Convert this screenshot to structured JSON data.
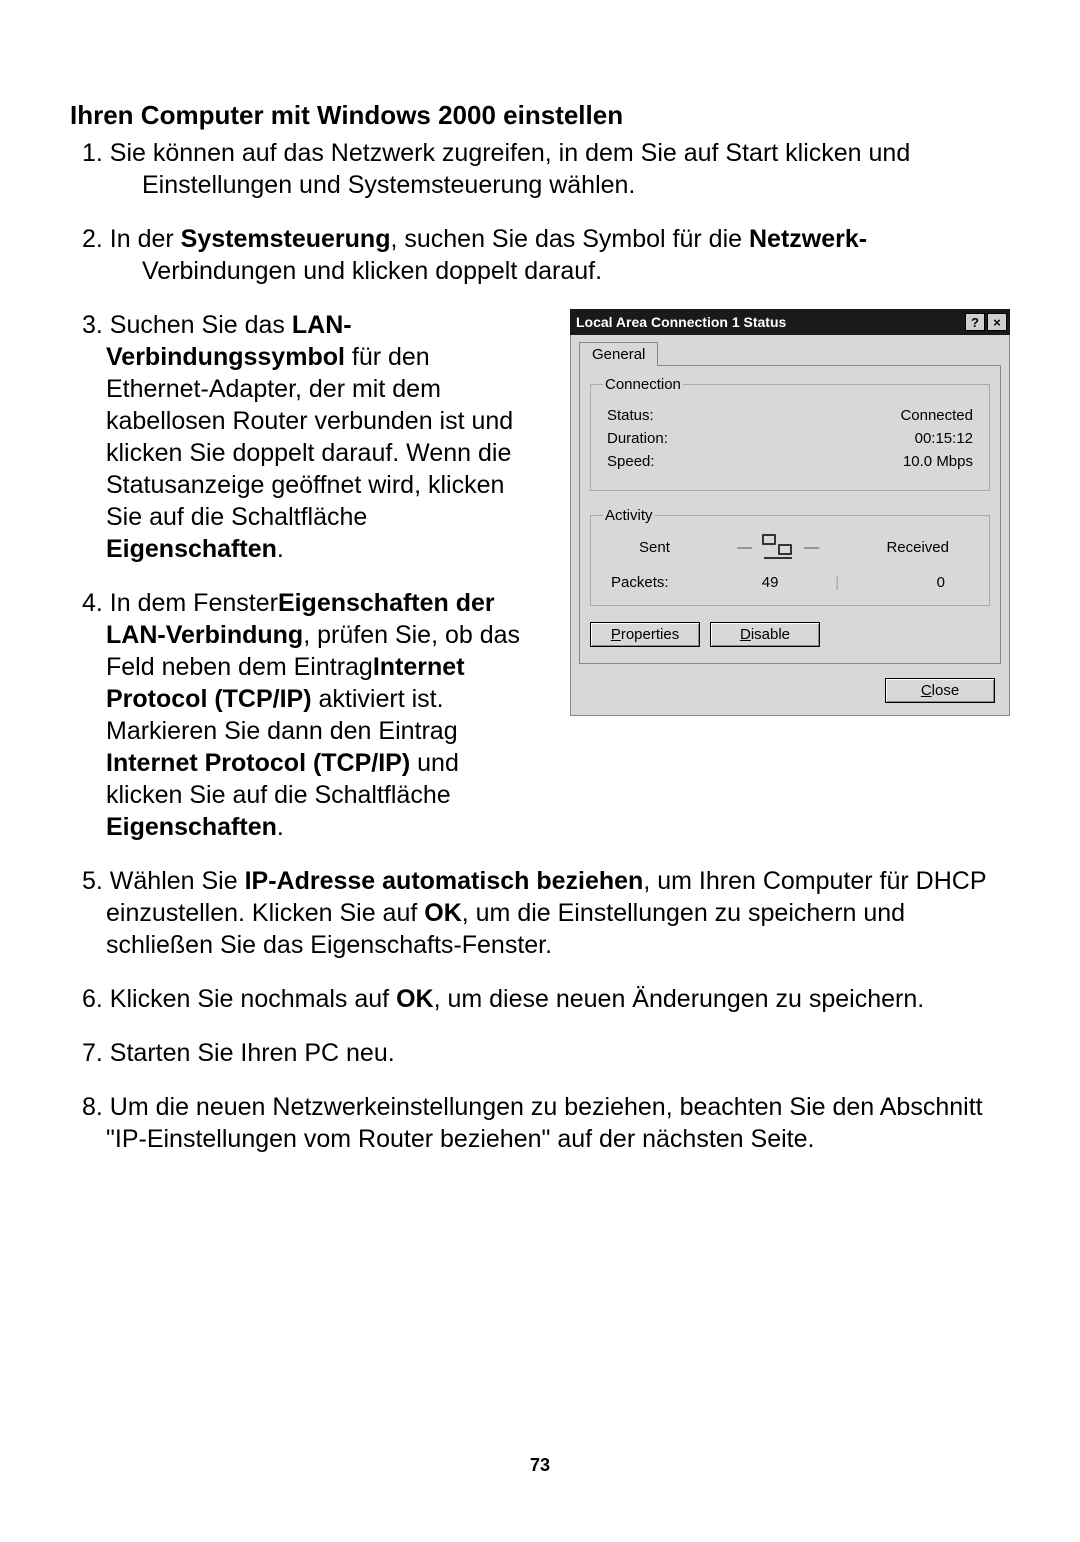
{
  "title": "Ihren Computer mit Windows 2000 einstellen",
  "steps": {
    "s1a": "1. Sie können auf das Netzwerk zugreifen, in dem Sie auf Start klicken und",
    "s1b": "Einstellungen und Systemsteuerung wählen.",
    "s2a": "2. In der ",
    "s2b": "Systemsteuerung",
    "s2c": ", suchen Sie das Symbol für die ",
    "s2d": "Netzwerk-",
    "s2e": "Verbindungen und klicken doppelt darauf.",
    "s3a": "3. Suchen Sie das ",
    "s3b": "LAN-Verbindungssymbol",
    "s3c": " für den Ethernet-Adapter, der mit dem kabellosen Router verbunden ist und klicken Sie doppelt darauf. Wenn die Statusanzeige geöffnet wird, klicken Sie auf die Schaltfläche ",
    "s3d": "Eigenschaften",
    "s3e": ".",
    "s4a": "4. In dem Fenster",
    "s4b": "Eigenschaften der LAN-Verbindung",
    "s4c": ", prüfen Sie, ob das Feld neben dem Eintrag",
    "s4d": "Internet Protocol (TCP/IP)",
    "s4e": " aktiviert ist. Markieren Sie dann den Eintrag ",
    "s4f": "Internet Protocol (TCP/IP)",
    "s4g": " und klicken Sie auf die Schaltfläche ",
    "s4h": "Eigenschaften",
    "s4i": ".",
    "s5a": "5. Wählen Sie  ",
    "s5b": "IP-Adresse automatisch beziehen",
    "s5c": ", um Ihren Computer für DHCP einzustellen. Klicken Sie auf ",
    "s5d": "OK",
    "s5e": ", um die Einstellungen zu speichern und schließen Sie das Eigenschafts-Fenster.",
    "s6a": "6. Klicken Sie nochmals auf ",
    "s6b": "OK",
    "s6c": ", um diese neuen Änderungen zu speichern.",
    "s7": "7. Starten Sie Ihren PC neu.",
    "s8": "8. Um die neuen Netzwerkeinstellungen zu beziehen, beachten Sie den Abschnitt \"IP-Einstellungen vom Router beziehen\" auf der nächsten Seite."
  },
  "dialog": {
    "title": "Local Area Connection 1 Status",
    "help": "?",
    "close_x": "×",
    "tab": "General",
    "connection": {
      "legend": "Connection",
      "status_label": "Status:",
      "status_value": "Connected",
      "duration_label": "Duration:",
      "duration_value": "00:15:12",
      "speed_label": "Speed:",
      "speed_value": "10.0 Mbps"
    },
    "activity": {
      "legend": "Activity",
      "sent": "Sent",
      "received": "Received",
      "packets_label": "Packets:",
      "packets_sent": "49",
      "packets_received": "0"
    },
    "buttons": {
      "properties_u": "P",
      "properties_rest": "roperties",
      "disable_u": "D",
      "disable_rest": "isable",
      "close_u": "C",
      "close_rest": "lose"
    }
  },
  "pagenum": "73"
}
